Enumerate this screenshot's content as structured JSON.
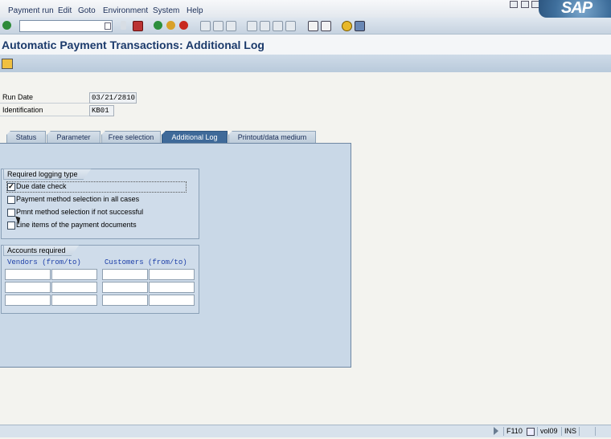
{
  "menu": {
    "items": [
      "Payment run",
      "Edit",
      "Goto",
      "Environment",
      "System",
      "Help"
    ],
    "logo": "SAP"
  },
  "toolbar": {
    "command_value": "",
    "icons": [
      "check-icon",
      "back-icon",
      "exit-icon",
      "cancel-icon",
      "print-icon",
      "find-icon",
      "find-next-icon",
      "first-page-icon",
      "prev-page-icon",
      "next-page-icon",
      "last-page-icon",
      "new-session-icon",
      "shortcut-icon",
      "help-icon",
      "layout-icon"
    ]
  },
  "page": {
    "title": "Automatic Payment Transactions: Additional Log"
  },
  "fields": {
    "run_date_label": "Run Date",
    "run_date_value": "03/21/2810",
    "identification_label": "Identification",
    "identification_value": "KB01"
  },
  "tabs": [
    "Status",
    "Parameter",
    "Free selection",
    "Additional Log",
    "Printout/data medium"
  ],
  "active_tab": "Additional Log",
  "logging_group": {
    "title": "Required logging type",
    "options": [
      {
        "label": "Due date check",
        "checked": true
      },
      {
        "label": "Payment method selection in all cases",
        "checked": false
      },
      {
        "label": "Pmnt method selection if not successful",
        "checked": false
      },
      {
        "label": "Line items of the payment documents",
        "checked": false
      }
    ]
  },
  "accounts_group": {
    "title": "Accounts required",
    "vendors_header": "Vendors (from/to)",
    "customers_header": "Customers (from/to)"
  },
  "status_bar": {
    "transaction": "F110",
    "server": "vol09",
    "mode": "INS"
  }
}
